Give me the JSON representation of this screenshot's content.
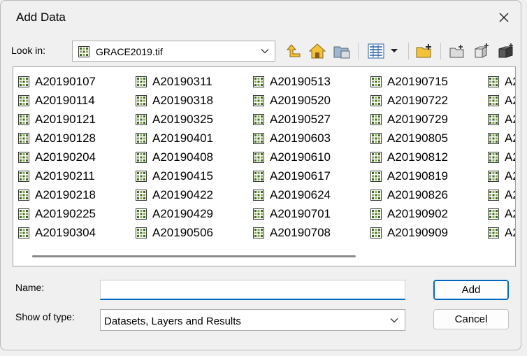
{
  "window": {
    "title": "Add Data"
  },
  "lookin": {
    "label": "Look in:",
    "value": "GRACE2019.tif"
  },
  "toolbar": [
    {
      "name": "up-one-level-icon"
    },
    {
      "name": "home-icon"
    },
    {
      "name": "connect-folder-icon"
    },
    {
      "name": "view-list-icon"
    },
    {
      "name": "new-folder-icon"
    },
    {
      "name": "new-file-geodatabase-icon"
    },
    {
      "name": "new-shapefile-icon"
    },
    {
      "name": "new-toolbox-icon"
    }
  ],
  "files": {
    "columns": [
      [
        "A20190107",
        "A20190114",
        "A20190121",
        "A20190128",
        "A20190204",
        "A20190211",
        "A20190218",
        "A20190225",
        "A20190304"
      ],
      [
        "A20190311",
        "A20190318",
        "A20190325",
        "A20190401",
        "A20190408",
        "A20190415",
        "A20190422",
        "A20190429",
        "A20190506"
      ],
      [
        "A20190513",
        "A20190520",
        "A20190527",
        "A20190603",
        "A20190610",
        "A20190617",
        "A20190624",
        "A20190701",
        "A20190708"
      ],
      [
        "A20190715",
        "A20190722",
        "A20190729",
        "A20190805",
        "A20190812",
        "A20190819",
        "A20190826",
        "A20190902",
        "A20190909"
      ],
      [
        "A2",
        "A2",
        "A2",
        "A2",
        "A2",
        "A2",
        "A2",
        "A2",
        "A2"
      ]
    ]
  },
  "name_field": {
    "label": "Name:",
    "value": ""
  },
  "type_field": {
    "label": "Show of type:",
    "value": "Datasets, Layers and Results"
  },
  "buttons": {
    "add": "Add",
    "cancel": "Cancel"
  },
  "colors": {
    "accent": "#0067c0",
    "raster_icon": "#5c8a3a"
  }
}
